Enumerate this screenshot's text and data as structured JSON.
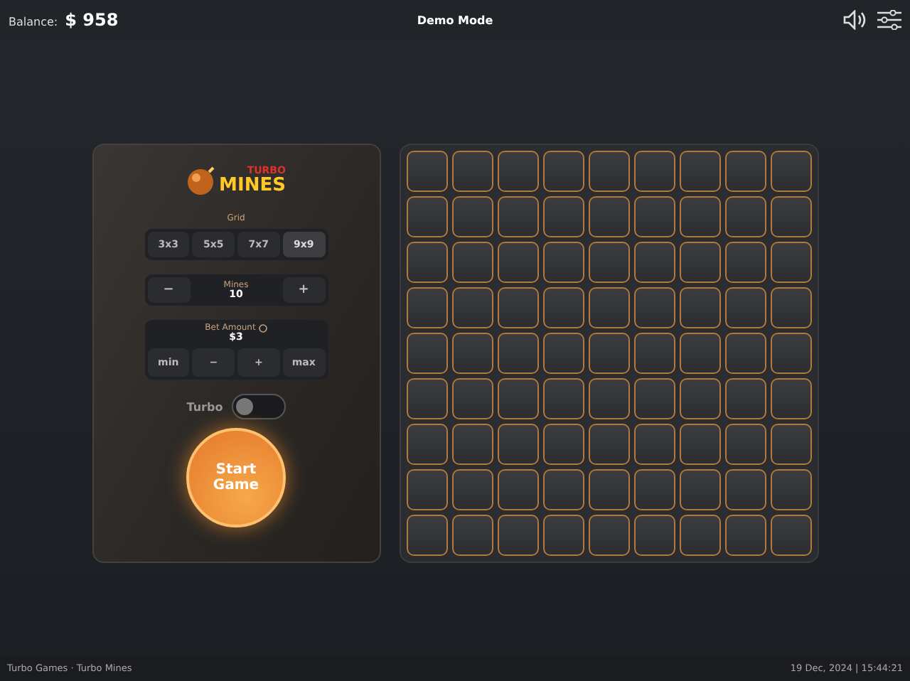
{
  "top_bar": {
    "balance_label": "Balance:",
    "balance": "$ 958",
    "mode": "Demo Mode"
  },
  "logo": {
    "top": "TURBO",
    "bottom": "MINES"
  },
  "grid": {
    "label": "Grid",
    "options": [
      {
        "label": "3x3",
        "selected": false
      },
      {
        "label": "5x5",
        "selected": false
      },
      {
        "label": "7x7",
        "selected": false
      },
      {
        "label": "9x9",
        "selected": true
      }
    ]
  },
  "mines": {
    "minus": "−",
    "label": "Mines",
    "value": "10",
    "plus": "+"
  },
  "bet": {
    "label": "Bet Amount",
    "value": "$3",
    "buttons": [
      "min",
      "−",
      "+",
      "max"
    ]
  },
  "turbo": {
    "label": "Turbo",
    "on": false
  },
  "start_button": "Start Game",
  "board": [
    [
      {
        "revealed": false
      },
      {
        "revealed": false
      },
      {
        "revealed": false
      },
      {
        "revealed": false
      },
      {
        "revealed": false
      },
      {
        "revealed": false
      },
      {
        "revealed": false
      },
      {
        "revealed": false
      },
      {
        "revealed": false
      }
    ],
    [
      {
        "revealed": false
      },
      {
        "revealed": false
      },
      {
        "revealed": false
      },
      {
        "revealed": false
      },
      {
        "revealed": false
      },
      {
        "revealed": false
      },
      {
        "revealed": false
      },
      {
        "revealed": false
      },
      {
        "revealed": false
      }
    ],
    [
      {
        "revealed": false
      },
      {
        "revealed": false
      },
      {
        "revealed": false
      },
      {
        "revealed": false
      },
      {
        "revealed": false
      },
      {
        "revealed": false
      },
      {
        "revealed": false
      },
      {
        "revealed": false
      },
      {
        "revealed": false
      }
    ],
    [
      {
        "revealed": false
      },
      {
        "revealed": false
      },
      {
        "revealed": false
      },
      {
        "revealed": false
      },
      {
        "revealed": false
      },
      {
        "revealed": false
      },
      {
        "revealed": false
      },
      {
        "revealed": false
      },
      {
        "revealed": false
      }
    ],
    [
      {
        "revealed": false
      },
      {
        "revealed": false
      },
      {
        "revealed": false
      },
      {
        "revealed": false
      },
      {
        "revealed": false
      },
      {
        "revealed": false
      },
      {
        "revealed": false
      },
      {
        "revealed": false
      },
      {
        "revealed": false
      }
    ],
    [
      {
        "revealed": false
      },
      {
        "revealed": false
      },
      {
        "revealed": false
      },
      {
        "revealed": false
      },
      {
        "revealed": false
      },
      {
        "revealed": false
      },
      {
        "revealed": false
      },
      {
        "revealed": false
      },
      {
        "revealed": false
      }
    ],
    [
      {
        "revealed": false
      },
      {
        "revealed": false
      },
      {
        "revealed": false
      },
      {
        "revealed": false
      },
      {
        "revealed": false
      },
      {
        "revealed": false
      },
      {
        "revealed": false
      },
      {
        "revealed": false
      },
      {
        "revealed": false
      }
    ],
    [
      {
        "revealed": false
      },
      {
        "revealed": false
      },
      {
        "revealed": false
      },
      {
        "revealed": false
      },
      {
        "revealed": false
      },
      {
        "revealed": false
      },
      {
        "revealed": false
      },
      {
        "revealed": false
      },
      {
        "revealed": false
      }
    ],
    [
      {
        "revealed": false
      },
      {
        "revealed": false
      },
      {
        "revealed": false
      },
      {
        "revealed": false
      },
      {
        "revealed": false
      },
      {
        "revealed": false
      },
      {
        "revealed": false
      },
      {
        "revealed": false
      },
      {
        "revealed": false
      }
    ]
  ],
  "footer": {
    "left": "Turbo Games · Turbo Mines",
    "right": "19 Dec, 2024 | 15:44:21"
  }
}
